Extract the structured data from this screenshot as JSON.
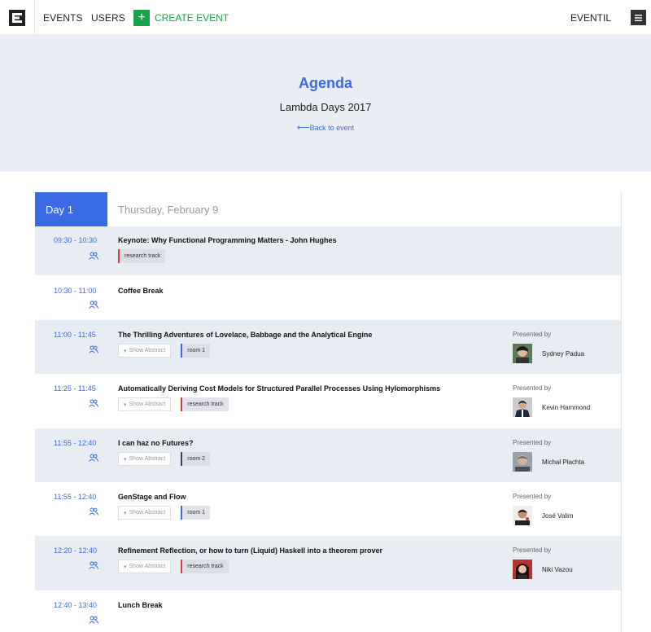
{
  "topbar": {
    "nav_events": "EVENTS",
    "nav_users": "USERS",
    "create_label": "CREATE EVENT",
    "brand": "EVENTIL",
    "accent_green": "#1aa24b",
    "icons": {
      "logo": "eventil-logo-icon",
      "plus": "plus-icon",
      "menu": "hamburger-menu-icon"
    }
  },
  "hero": {
    "title": "Agenda",
    "subtitle": "Lambda Days 2017",
    "back_label": "Back to event",
    "accent_blue": "#3a6ae4"
  },
  "day": {
    "tab_label": "Day 1",
    "date": "Thursday, February 9"
  },
  "labels": {
    "show_abstract": "Show Abstract",
    "presented_by": "Presented by"
  },
  "sessions": [
    {
      "time": "09:30 - 10:30",
      "title": "Keynote: Why Functional Programming Matters - John Hughes",
      "track": "research track",
      "track_color": "#d53a3a",
      "abstract": false,
      "speaker": ""
    },
    {
      "time": "10:30 - 11:00",
      "title": "Coffee Break",
      "track": "",
      "abstract": false,
      "speaker": ""
    },
    {
      "time": "11:00 - 11:45",
      "title": "The Thrilling Adventures of Lovelace, Babbage and the Analytical Engine",
      "track": "room 1",
      "track_color": "#3a6ae4",
      "abstract": true,
      "speaker": "Sydney Padua"
    },
    {
      "time": "11:25 - 11:45",
      "title": "Automatically Deriving Cost Models for Structured Parallel Processes Using Hylomorphisms",
      "track": "research track",
      "track_color": "#d53a3a",
      "abstract": true,
      "speaker": "Kevin Hammond"
    },
    {
      "time": "11:55 - 12:40",
      "title": "I can haz no Futures?",
      "track": "room 2",
      "track_color": "#3b3f6b",
      "abstract": true,
      "speaker": "Michał Płachta"
    },
    {
      "time": "11:55 - 12:40",
      "title": "GenStage and Flow",
      "track": "room 1",
      "track_color": "#3a6ae4",
      "abstract": true,
      "speaker": "José Valim"
    },
    {
      "time": "12:20 - 12:40",
      "title": "Refinement Reflection, or how to turn (Liquid) Haskell into a theorem prover",
      "track": "research track",
      "track_color": "#d53a3a",
      "abstract": true,
      "speaker": "Niki Vazou"
    },
    {
      "time": "12:40 - 13:40",
      "title": "Lunch Break",
      "track": "",
      "abstract": false,
      "speaker": ""
    }
  ]
}
